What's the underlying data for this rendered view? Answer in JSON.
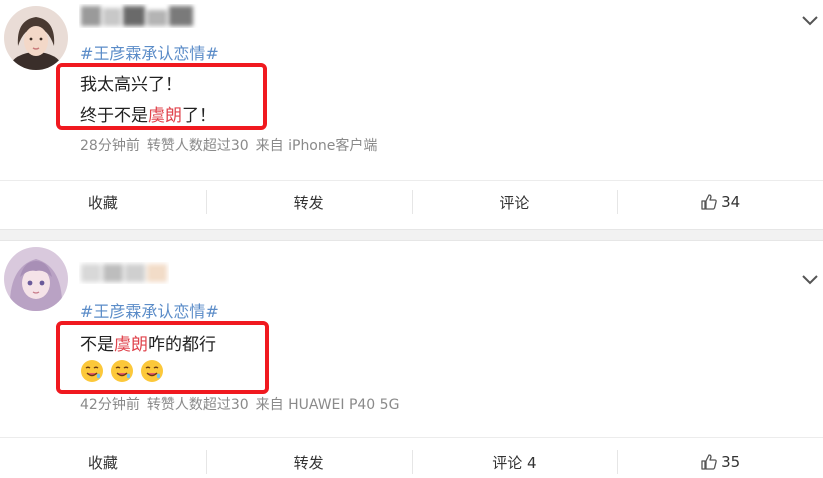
{
  "posts": [
    {
      "hashtag": "#王彦霖承认恋情#",
      "lines": [
        [
          "我太高兴了！"
        ],
        [
          "终于不是",
          "虞朗",
          "了！"
        ]
      ],
      "meta": {
        "time": "28分钟前",
        "reposts": "转赞人数超过30",
        "source": "来自 iPhone客户端"
      },
      "actions": {
        "favorite": "收藏",
        "repost": "转发",
        "comment": "评论",
        "likes": "34"
      }
    },
    {
      "hashtag": "#王彦霖承认恋情#",
      "lines": [
        [
          "不是",
          "虞朗",
          "咋的都行"
        ]
      ],
      "emojis": [
        "drooling-face-emoji",
        "drooling-face-emoji",
        "drooling-face-emoji"
      ],
      "meta": {
        "time": "42分钟前",
        "reposts": "转赞人数超过30",
        "source": "来自 HUAWEI P40 5G"
      },
      "actions": {
        "favorite": "收藏",
        "repost": "转发",
        "comment": "评论 4",
        "likes": "35"
      }
    }
  ],
  "colors": {
    "hashtag": "#5b8cc8",
    "highlight": "#e0444d",
    "redbox": "#f0191f",
    "meta": "#8a8a8a"
  }
}
